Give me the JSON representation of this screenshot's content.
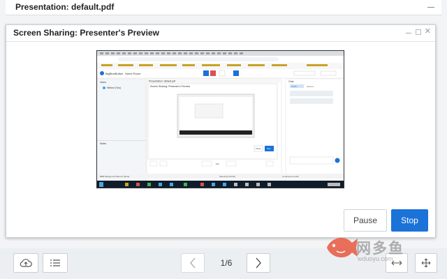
{
  "background_window": {
    "title": "Presentation: default.pdf"
  },
  "modal": {
    "title": "Screen Sharing: Presenter's Preview",
    "pause_label": "Pause",
    "stop_label": "Stop"
  },
  "preview": {
    "app_name": "BigBlueButton",
    "room_name": "Home Room",
    "users_heading": "Users",
    "user_name": "Nelson (You)",
    "notes_heading": "Notes",
    "chat_heading": "Chat",
    "chat_tab_public": "Public",
    "chat_tab_options": "Options",
    "inner_presentation_title": "Presentation: default.pdf",
    "inner_modal_title": "Screen Sharing: Presenter's Preview",
    "inner_pause": "Pause",
    "inner_stop": "Stop",
    "inner_page": "1/6",
    "status_left": "BBB Background Banner (Beta)",
    "status_mid": "(Meeting) (00:00)",
    "status_right": "Conference Audio"
  },
  "toolbar": {
    "page_indicator": "1/6"
  },
  "watermark": {
    "text": "网多鱼",
    "sub": "wduoyu.com"
  },
  "colors": {
    "accent": "#1b72d9",
    "watermark_fish": "#e8573f"
  }
}
